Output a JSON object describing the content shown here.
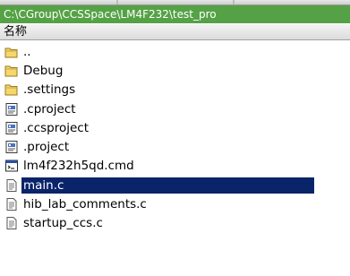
{
  "path_bar": {
    "text": "C:\\CGroup\\CCSSpace\\LM4F232\\test_pro"
  },
  "list_header": {
    "name_label": "名称"
  },
  "items": [
    {
      "label": "..",
      "icon": "folder-up-icon"
    },
    {
      "label": "Debug",
      "icon": "folder-icon"
    },
    {
      "label": ".settings",
      "icon": "folder-icon"
    },
    {
      "label": ".cproject",
      "icon": "project-file-icon"
    },
    {
      "label": ".ccsproject",
      "icon": "project-file-icon"
    },
    {
      "label": ".project",
      "icon": "project-file-icon"
    },
    {
      "label": "lm4f232h5qd.cmd",
      "icon": "cmd-file-icon"
    },
    {
      "label": "main.c",
      "icon": "c-file-icon",
      "selected": true
    },
    {
      "label": "hib_lab_comments.c",
      "icon": "c-file-icon"
    },
    {
      "label": "startup_ccs.c",
      "icon": "c-file-icon"
    }
  ],
  "colors": {
    "path_bar_bg": "#55a246",
    "selection_bg": "#0a246a",
    "folder_yellow": "#f5d76e"
  }
}
